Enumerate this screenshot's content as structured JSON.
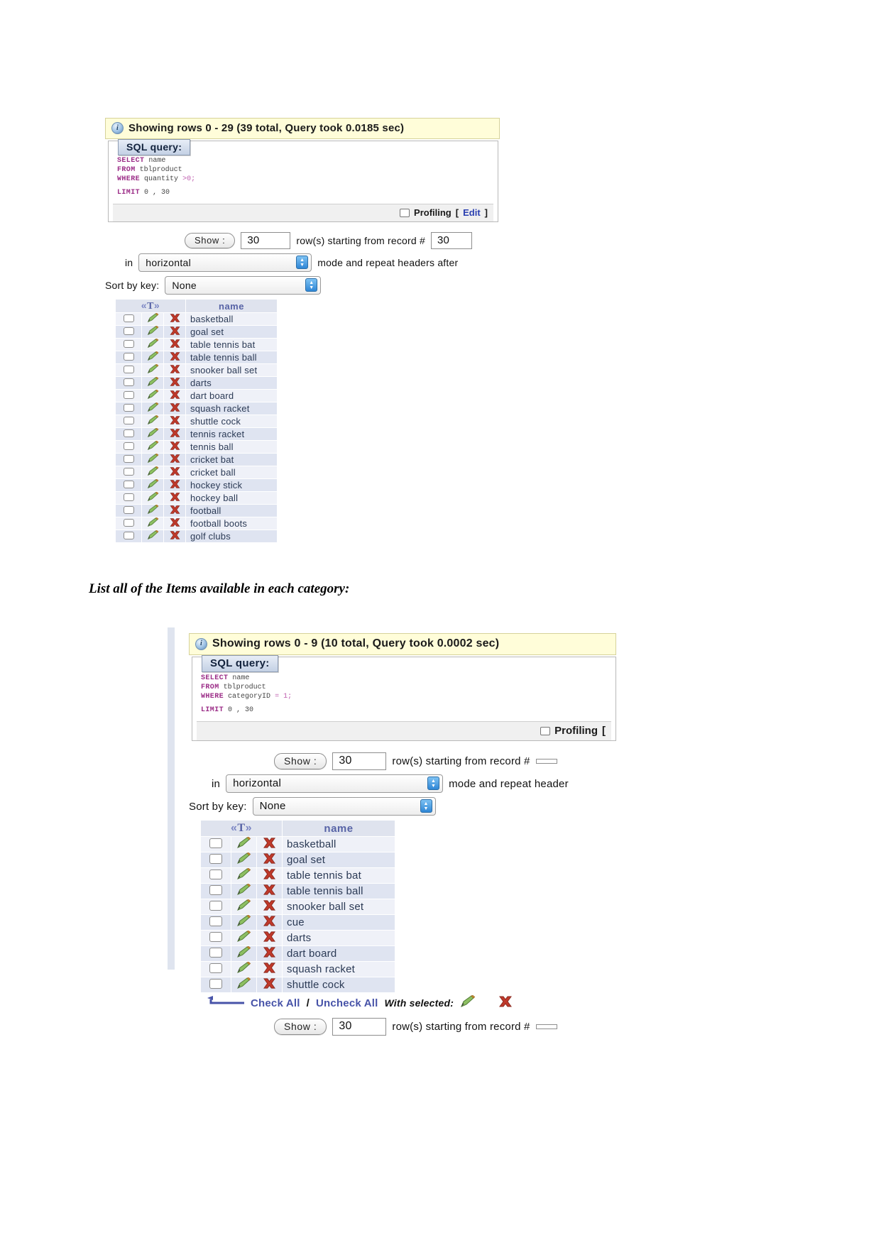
{
  "document": {
    "caption": "List all of the Items available in each category:"
  },
  "panel1": {
    "name": "products-in-stock-result",
    "status": "Showing rows 0 - 29 (39 total, Query took 0.0185 sec)",
    "info_icon": "info-icon",
    "sql_legend": "SQL query:",
    "sql": {
      "line1_kw": "SELECT",
      "line1_val": "name",
      "line2_kw": "FROM",
      "line2_val": "tblproduct",
      "line3_kw": "WHERE",
      "line3_val": "quantity",
      "line3_num": ">0;",
      "line4_kw": "LIMIT",
      "line4_val": "0 , 30"
    },
    "footer": {
      "profiling_label": "Profiling",
      "bracket_open": "[",
      "edit_label": "Edit",
      "bracket_close": "]"
    },
    "controls": {
      "show_button": "Show :",
      "rows_value": "30",
      "rows_label": "row(s) starting from record #",
      "start_record_value": "30",
      "in_label": "in",
      "mode_value": "horizontal",
      "mode_label": "mode and repeat headers after",
      "sort_label": "Sort by key:",
      "sort_value": "None"
    },
    "table": {
      "header_tools": "« T »",
      "header_name": "name",
      "rows": [
        "basketball",
        "goal set",
        "table tennis bat",
        "table tennis ball",
        "snooker ball set",
        "darts",
        "dart board",
        "squash racket",
        "shuttle cock",
        "tennis racket",
        "tennis ball",
        "cricket bat",
        "cricket ball",
        "hockey stick",
        "hockey ball",
        "football",
        "football boots",
        "golf clubs"
      ]
    }
  },
  "panel2": {
    "name": "category-items-result",
    "status": "Showing rows 0 - 9 (10 total, Query took 0.0002 sec)",
    "info_icon": "info-icon",
    "sql_legend": "SQL query:",
    "sql": {
      "line1_kw": "SELECT",
      "line1_val": "name",
      "line2_kw": "FROM",
      "line2_val": "tblproduct",
      "line3_kw": "WHERE",
      "line3_val": "categoryID",
      "line3_num": "= 1;",
      "line4_kw": "LIMIT",
      "line4_val": "0 , 30"
    },
    "footer": {
      "profiling_label": "Profiling",
      "bracket_open": "[",
      "edit_label": "",
      "bracket_close": ""
    },
    "controls": {
      "show_button": "Show :",
      "rows_value": "30",
      "rows_label": "row(s) starting from record #",
      "start_record_value": "",
      "in_label": "in",
      "mode_value": "horizontal",
      "mode_label": "mode and repeat header",
      "sort_label": "Sort by key:",
      "sort_value": "None"
    },
    "table": {
      "header_tools": "« T »",
      "header_name": "name",
      "rows": [
        "basketball",
        "goal set",
        "table tennis bat",
        "table tennis ball",
        "snooker ball set",
        "cue",
        "darts",
        "dart board",
        "squash racket",
        "shuttle cock"
      ]
    },
    "table_footer": {
      "check_all": "Check All",
      "slash": "/",
      "uncheck_all": "Uncheck All",
      "with_selected": "With selected:"
    },
    "bottom_controls": {
      "show_button": "Show :",
      "rows_value": "30",
      "rows_label": "row(s) starting from record #"
    }
  },
  "colors": {
    "status_bg": "#fffdd9",
    "status_border": "#d6d29a",
    "legend_bg": "#c3d0e4",
    "keyword": "#9b2c87",
    "link": "#4753a8",
    "row_odd": "#eff1f8",
    "row_even": "#dfe4f1",
    "header_bg": "#dfe3ee"
  }
}
